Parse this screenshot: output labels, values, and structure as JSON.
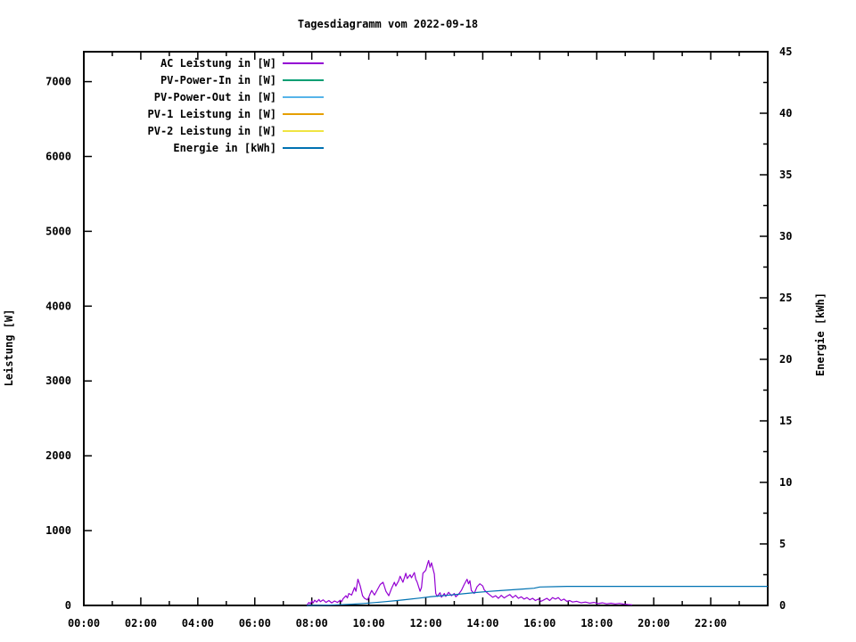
{
  "chart_data": {
    "type": "line",
    "title": "Tagesdiagramm vom 2022-09-18",
    "ylabel": "Leistung [W]",
    "y2label": "Energie [kWh]",
    "background_color": "#ffffff",
    "text_color": "#000000",
    "grid": "off",
    "legend_position": "top-left-inside",
    "x_axis": {
      "range_hours": [
        0,
        24
      ],
      "major_step_hours": 2,
      "minor_step_hours": 1,
      "tick_labels": [
        "00:00",
        "02:00",
        "04:00",
        "06:00",
        "08:00",
        "10:00",
        "12:00",
        "14:00",
        "16:00",
        "18:00",
        "20:00",
        "22:00"
      ]
    },
    "y_axis": {
      "range": [
        0,
        7400
      ],
      "major_step": 1000,
      "tick_values": [
        0,
        1000,
        2000,
        3000,
        4000,
        5000,
        6000,
        7000
      ],
      "tick_labels": [
        "0",
        "1000",
        "2000",
        "3000",
        "4000",
        "5000",
        "6000",
        "7000"
      ]
    },
    "y2_axis": {
      "range": [
        0,
        45
      ],
      "major_step": 5,
      "minor_step": 2.5,
      "tick_values": [
        0,
        5,
        10,
        15,
        20,
        25,
        30,
        35,
        40,
        45
      ],
      "tick_labels": [
        "0",
        "5",
        "10",
        "15",
        "20",
        "25",
        "30",
        "35",
        "40",
        "45"
      ]
    },
    "series": [
      {
        "name": "AC Leistung in [W]",
        "color": "#9400d3",
        "axis": "y1",
        "points": [
          [
            7.83,
            5
          ],
          [
            7.9,
            40
          ],
          [
            7.95,
            20
          ],
          [
            8.0,
            60
          ],
          [
            8.05,
            35
          ],
          [
            8.1,
            70
          ],
          [
            8.17,
            45
          ],
          [
            8.25,
            80
          ],
          [
            8.3,
            50
          ],
          [
            8.4,
            75
          ],
          [
            8.5,
            40
          ],
          [
            8.6,
            65
          ],
          [
            8.7,
            35
          ],
          [
            8.8,
            60
          ],
          [
            8.9,
            40
          ],
          [
            9.0,
            70
          ],
          [
            9.05,
            50
          ],
          [
            9.1,
            90
          ],
          [
            9.2,
            130
          ],
          [
            9.25,
            100
          ],
          [
            9.3,
            160
          ],
          [
            9.4,
            140
          ],
          [
            9.5,
            240
          ],
          [
            9.55,
            190
          ],
          [
            9.62,
            350
          ],
          [
            9.7,
            260
          ],
          [
            9.78,
            130
          ],
          [
            9.85,
            95
          ],
          [
            9.95,
            75
          ],
          [
            10.0,
            110
          ],
          [
            10.05,
            160
          ],
          [
            10.1,
            200
          ],
          [
            10.2,
            140
          ],
          [
            10.3,
            210
          ],
          [
            10.4,
            280
          ],
          [
            10.5,
            310
          ],
          [
            10.55,
            250
          ],
          [
            10.6,
            190
          ],
          [
            10.7,
            130
          ],
          [
            10.8,
            230
          ],
          [
            10.9,
            310
          ],
          [
            10.95,
            260
          ],
          [
            11.05,
            330
          ],
          [
            11.1,
            390
          ],
          [
            11.2,
            310
          ],
          [
            11.3,
            430
          ],
          [
            11.35,
            360
          ],
          [
            11.45,
            410
          ],
          [
            11.5,
            370
          ],
          [
            11.6,
            440
          ],
          [
            11.65,
            350
          ],
          [
            11.7,
            310
          ],
          [
            11.8,
            190
          ],
          [
            11.85,
            240
          ],
          [
            11.9,
            430
          ],
          [
            12.0,
            470
          ],
          [
            12.05,
            540
          ],
          [
            12.1,
            600
          ],
          [
            12.15,
            510
          ],
          [
            12.2,
            570
          ],
          [
            12.3,
            420
          ],
          [
            12.35,
            160
          ],
          [
            12.4,
            120
          ],
          [
            12.5,
            170
          ],
          [
            12.55,
            110
          ],
          [
            12.65,
            160
          ],
          [
            12.7,
            120
          ],
          [
            12.8,
            175
          ],
          [
            12.9,
            130
          ],
          [
            13.0,
            160
          ],
          [
            13.05,
            115
          ],
          [
            13.15,
            150
          ],
          [
            13.25,
            200
          ],
          [
            13.35,
            280
          ],
          [
            13.45,
            350
          ],
          [
            13.5,
            290
          ],
          [
            13.55,
            330
          ],
          [
            13.6,
            200
          ],
          [
            13.7,
            160
          ],
          [
            13.8,
            250
          ],
          [
            13.9,
            290
          ],
          [
            14.0,
            260
          ],
          [
            14.05,
            210
          ],
          [
            14.15,
            170
          ],
          [
            14.25,
            140
          ],
          [
            14.35,
            110
          ],
          [
            14.45,
            130
          ],
          [
            14.55,
            95
          ],
          [
            14.65,
            135
          ],
          [
            14.75,
            100
          ],
          [
            14.85,
            125
          ],
          [
            14.95,
            145
          ],
          [
            15.05,
            105
          ],
          [
            15.15,
            135
          ],
          [
            15.25,
            95
          ],
          [
            15.35,
            115
          ],
          [
            15.45,
            85
          ],
          [
            15.55,
            105
          ],
          [
            15.65,
            75
          ],
          [
            15.75,
            95
          ],
          [
            15.85,
            65
          ],
          [
            15.95,
            85
          ],
          [
            16.05,
            55
          ],
          [
            16.15,
            75
          ],
          [
            16.25,
            95
          ],
          [
            16.35,
            65
          ],
          [
            16.45,
            105
          ],
          [
            16.55,
            85
          ],
          [
            16.65,
            105
          ],
          [
            16.75,
            65
          ],
          [
            16.85,
            85
          ],
          [
            16.95,
            55
          ],
          [
            17.05,
            65
          ],
          [
            17.15,
            45
          ],
          [
            17.3,
            55
          ],
          [
            17.45,
            35
          ],
          [
            17.6,
            45
          ],
          [
            17.75,
            30
          ],
          [
            17.9,
            40
          ],
          [
            18.05,
            25
          ],
          [
            18.2,
            35
          ],
          [
            18.35,
            22
          ],
          [
            18.5,
            30
          ],
          [
            18.65,
            20
          ],
          [
            18.8,
            28
          ],
          [
            18.95,
            18
          ],
          [
            19.1,
            12
          ],
          [
            19.25,
            8
          ]
        ]
      },
      {
        "name": "PV-Power-In in [W]",
        "color": "#009e73",
        "axis": "y1",
        "points": []
      },
      {
        "name": "PV-Power-Out in [W]",
        "color": "#56b4e9",
        "axis": "y1",
        "points": []
      },
      {
        "name": "PV-1 Leistung in [W]",
        "color": "#e69f00",
        "axis": "y1",
        "points": []
      },
      {
        "name": "PV-2 Leistung in [W]",
        "color": "#f0e442",
        "axis": "y1",
        "points": []
      },
      {
        "name": "Energie in [kWh]",
        "color": "#0072b2",
        "axis": "y2",
        "points": [
          [
            7.83,
            0
          ],
          [
            8.2,
            0.01
          ],
          [
            8.6,
            0.03
          ],
          [
            9.0,
            0.06
          ],
          [
            9.4,
            0.1
          ],
          [
            9.8,
            0.16
          ],
          [
            10.2,
            0.23
          ],
          [
            10.6,
            0.31
          ],
          [
            11.0,
            0.4
          ],
          [
            11.4,
            0.5
          ],
          [
            11.8,
            0.6
          ],
          [
            12.2,
            0.72
          ],
          [
            12.6,
            0.8
          ],
          [
            13.0,
            0.88
          ],
          [
            13.4,
            0.97
          ],
          [
            13.8,
            1.06
          ],
          [
            14.2,
            1.14
          ],
          [
            14.6,
            1.2
          ],
          [
            15.0,
            1.27
          ],
          [
            15.4,
            1.33
          ],
          [
            15.8,
            1.4
          ],
          [
            16.0,
            1.5
          ],
          [
            16.6,
            1.53
          ],
          [
            17.0,
            1.55
          ],
          [
            18.0,
            1.55
          ],
          [
            20.0,
            1.55
          ],
          [
            22.0,
            1.55
          ],
          [
            24.0,
            1.55
          ]
        ]
      }
    ]
  }
}
